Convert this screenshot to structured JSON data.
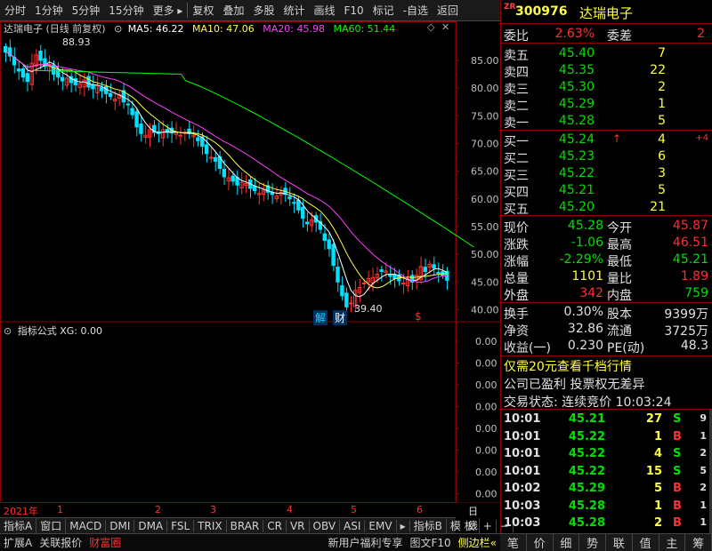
{
  "toolbar": {
    "items": [
      "分时",
      "1分钟",
      "5分钟",
      "15分钟",
      "更多 ▸",
      "复权",
      "叠加",
      "多股",
      "统计",
      "画线",
      "F10",
      "标记",
      "-自选",
      "返回"
    ]
  },
  "stock": {
    "prefix": "ZR",
    "code": "300976",
    "name": "达瑞电子"
  },
  "chart_title": {
    "name": "达瑞电子 (日线 前复权)",
    "ma5": "MA5: 46.22",
    "ma10": "MA10: 47.06",
    "ma20": "MA20: 45.98",
    "ma60": "MA60: 51.44"
  },
  "price_axis": [
    "85.00",
    "80.00",
    "75.00",
    "70.00",
    "65.00",
    "60.00",
    "55.00",
    "50.00",
    "45.00",
    "40.00"
  ],
  "annotations": {
    "high": "88.93",
    "low": "39.40",
    "jie": "解",
    "cai": "财",
    "dollar": "$"
  },
  "indicator": {
    "title": "指标公式 XG: 0.00",
    "axis": [
      "0.00",
      "0.00",
      "0.00",
      "0.00",
      "0.00",
      "0.00",
      "0.00",
      "0.00"
    ]
  },
  "date_axis": [
    "2021年",
    "1",
    "2",
    "3",
    "4",
    "5",
    "6"
  ],
  "date_axis_right": "日线",
  "indicator_tabs": [
    "指标A",
    "窗口",
    "MACD",
    "DMI",
    "DMA",
    "FSL",
    "TRIX",
    "BRAR",
    "CR",
    "VR",
    "OBV",
    "ASI",
    "EMV",
    "▸",
    "指标B",
    "模 板",
    "+",
    "−"
  ],
  "bottom_bar": {
    "ext": "扩展A",
    "link": "关联报价",
    "fortune": "财富圈",
    "promo": "新用户福利专享",
    "f10": "图文F10",
    "side": "侧边栏«"
  },
  "right_tabs": [
    "笔",
    "价",
    "细",
    "势",
    "联",
    "值",
    "主",
    "筹"
  ],
  "ratio": {
    "label1": "委比",
    "val1": "2.63%",
    "label2": "委差",
    "val2": "2"
  },
  "sells": [
    {
      "label": "卖五",
      "price": "45.40",
      "vol": "7"
    },
    {
      "label": "卖四",
      "price": "45.35",
      "vol": "22"
    },
    {
      "label": "卖三",
      "price": "45.30",
      "vol": "2"
    },
    {
      "label": "卖二",
      "price": "45.29",
      "vol": "1"
    },
    {
      "label": "卖一",
      "price": "45.28",
      "vol": "5"
    }
  ],
  "buys": [
    {
      "label": "买一",
      "price": "45.24",
      "vol": "4",
      "arrow": "↑",
      "chg": "+4"
    },
    {
      "label": "买二",
      "price": "45.23",
      "vol": "6"
    },
    {
      "label": "买三",
      "price": "45.22",
      "vol": "3"
    },
    {
      "label": "买四",
      "price": "45.21",
      "vol": "5"
    },
    {
      "label": "买五",
      "price": "45.20",
      "vol": "21"
    }
  ],
  "quote": [
    {
      "l1": "现价",
      "v1": "45.28",
      "l2": "今开",
      "v2": "45.87"
    },
    {
      "l1": "涨跌",
      "v1": "-1.06",
      "l2": "最高",
      "v2": "46.51"
    },
    {
      "l1": "涨幅",
      "v1": "-2.29%",
      "l2": "最低",
      "v2": "45.21"
    },
    {
      "l1": "总量",
      "v1": "1101",
      "l2": "量比",
      "v2": "1.89"
    },
    {
      "l1": "外盘",
      "v1": "342",
      "l2": "内盘",
      "v2": "759"
    }
  ],
  "fund": [
    {
      "l1": "换手",
      "v1": "0.30%",
      "l2": "股本",
      "v2": "9399万"
    },
    {
      "l1": "净资",
      "v1": "32.86",
      "l2": "流通",
      "v2": "3725万"
    },
    {
      "l1": "收益(一)",
      "v1": "0.230",
      "l2": "PE(动)",
      "v2": "48.3"
    }
  ],
  "notices": {
    "promo": "仅需20元查看千档行情",
    "status1": "公司已盈利 投票权无差异",
    "status2": "交易状态: 连续竞价 10:03:24"
  },
  "ticks": [
    {
      "time": "10:01",
      "price": "45.21",
      "vol": "27",
      "bs": "S",
      "n": "9"
    },
    {
      "time": "10:01",
      "price": "45.22",
      "vol": "1",
      "bs": "B",
      "n": "1"
    },
    {
      "time": "10:01",
      "price": "45.22",
      "vol": "4",
      "bs": "S",
      "n": "2"
    },
    {
      "time": "10:01",
      "price": "45.22",
      "vol": "15",
      "bs": "S",
      "n": "5"
    },
    {
      "time": "10:02",
      "price": "45.29",
      "vol": "5",
      "bs": "B",
      "n": "2"
    },
    {
      "time": "10:03",
      "price": "45.28",
      "vol": "1",
      "bs": "B",
      "n": "1"
    },
    {
      "time": "10:03",
      "price": "45.28",
      "vol": "2",
      "bs": "B",
      "n": "1"
    }
  ],
  "chart_data": {
    "type": "candlestick",
    "price_range": [
      37.5,
      89.5
    ],
    "ma_lines": [
      "MA5",
      "MA10",
      "MA20",
      "MA60"
    ],
    "closes": [
      86.5,
      85.8,
      84.2,
      83.1,
      82.0,
      81.2,
      84.5,
      86.0,
      85.0,
      83.9,
      84.3,
      82.5,
      82.0,
      81.3,
      81.8,
      81.0,
      80.6,
      80.8,
      81.5,
      80.2,
      79.9,
      80.4,
      79.5,
      79.0,
      78.5,
      78.0,
      78.8,
      77.5,
      77.0,
      75.2,
      73.0,
      71.8,
      71.5,
      72.5,
      72.0,
      71.8,
      72.5,
      72.0,
      71.9,
      72.1,
      71.5,
      72.0,
      71.8,
      71.5,
      70.5,
      69.5,
      68.2,
      67.5,
      66.8,
      65.5,
      64.0,
      63.8,
      63.2,
      62.5,
      63.0,
      62.8,
      61.9,
      61.5,
      61.0,
      61.6,
      61.2,
      60.8,
      60.5,
      61.2,
      60.8,
      60.0,
      59.2,
      58.0,
      56.5,
      55.5,
      56.2,
      55.8,
      54.5,
      52.5,
      51.0,
      48.0,
      45.0,
      42.5,
      40.5,
      41.2,
      43.5,
      44.0,
      44.8,
      45.6,
      45.8,
      46.4,
      46.9,
      47.0,
      46.0,
      45.6,
      45.2,
      44.8,
      45.5,
      45.0,
      46.2,
      47.8,
      46.9,
      48.2,
      47.5,
      46.6,
      46.2,
      45.3
    ]
  }
}
